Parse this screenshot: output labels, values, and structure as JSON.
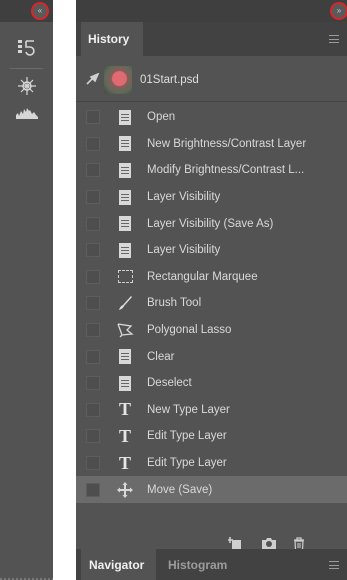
{
  "strip": {
    "collapse_label": "«",
    "icons": [
      "history-toggle-icon",
      "navigator-icon",
      "histogram-icon"
    ]
  },
  "panel": {
    "expand_label": "»",
    "tab_history": "History",
    "snapshot": {
      "name": "01Start.psd"
    },
    "items": [
      {
        "label": "Open",
        "icon": "document-icon"
      },
      {
        "label": "New Brightness/Contrast Layer",
        "icon": "document-icon"
      },
      {
        "label": "Modify Brightness/Contrast L...",
        "icon": "document-icon"
      },
      {
        "label": "Layer Visibility",
        "icon": "document-icon"
      },
      {
        "label": "Layer Visibility (Save As)",
        "icon": "document-icon"
      },
      {
        "label": "Layer Visibility",
        "icon": "document-icon"
      },
      {
        "label": "Rectangular Marquee",
        "icon": "marquee-icon"
      },
      {
        "label": "Brush Tool",
        "icon": "brush-icon"
      },
      {
        "label": "Polygonal Lasso",
        "icon": "lasso-icon"
      },
      {
        "label": "Clear",
        "icon": "document-icon"
      },
      {
        "label": "Deselect",
        "icon": "document-icon"
      },
      {
        "label": "New Type Layer",
        "icon": "type-icon"
      },
      {
        "label": "Edit Type Layer",
        "icon": "type-icon"
      },
      {
        "label": "Edit Type Layer",
        "icon": "type-icon"
      },
      {
        "label": "Move (Save)",
        "icon": "move-icon",
        "selected": true
      }
    ]
  },
  "bottom_tabs": {
    "navigator": "Navigator",
    "histogram": "Histogram"
  }
}
